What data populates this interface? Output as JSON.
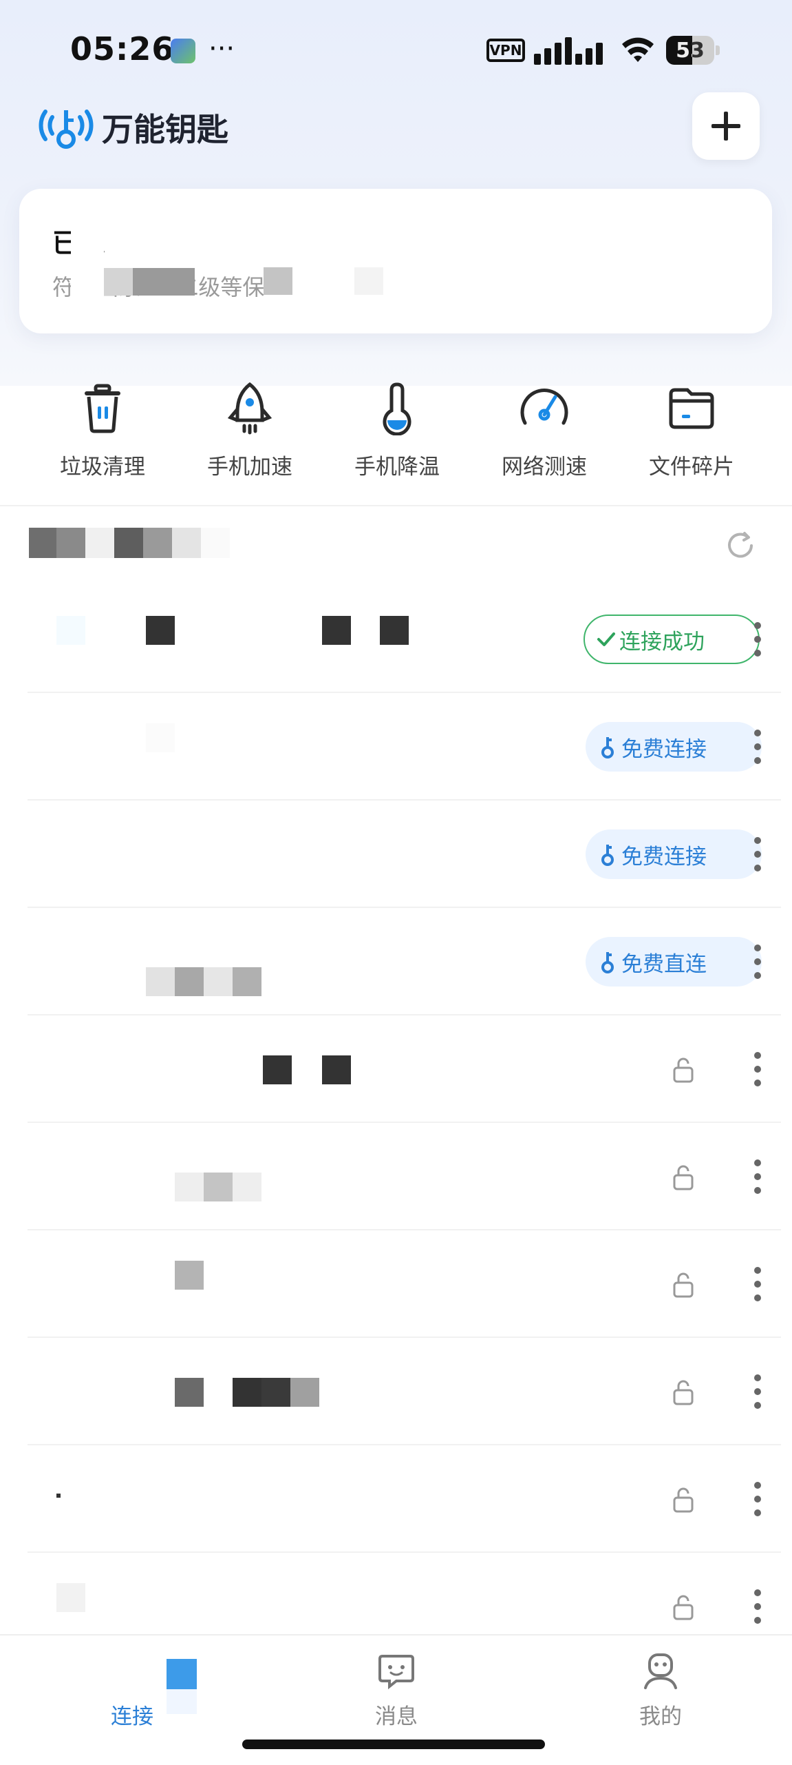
{
  "status_bar": {
    "time": "05:26",
    "dots": "···",
    "vpn": "VPN",
    "battery": "53"
  },
  "header": {
    "app_title": "万能钥匙",
    "add_icon": "plus-icon"
  },
  "connected_card": {
    "title": "已连",
    "subtitle": "符合国家 … 二级等保"
  },
  "tools": [
    {
      "label": "垃圾清理",
      "icon": "trash-icon"
    },
    {
      "label": "手机加速",
      "icon": "rocket-icon"
    },
    {
      "label": "手机降温",
      "icon": "thermometer-icon"
    },
    {
      "label": "网络测速",
      "icon": "speedometer-icon"
    },
    {
      "label": "文件碎片",
      "icon": "folder-icon"
    }
  ],
  "list": {
    "refresh_icon": "refresh-icon",
    "rows": [
      {
        "status": "连接成功",
        "type": "success"
      },
      {
        "status": "免费连接",
        "type": "free"
      },
      {
        "status": "免费连接",
        "type": "free"
      },
      {
        "status": "免费直连",
        "type": "free"
      },
      {
        "status": "",
        "type": "lock"
      },
      {
        "status": "",
        "type": "lock"
      },
      {
        "status": "",
        "type": "lock"
      },
      {
        "status": "",
        "type": "lock"
      },
      {
        "status": "",
        "type": "lock"
      },
      {
        "status": "",
        "type": "lock"
      }
    ]
  },
  "bottom_nav": {
    "items": [
      {
        "label": "连接",
        "icon": "wifi-key-icon",
        "active": true
      },
      {
        "label": "消息",
        "icon": "message-icon",
        "active": false
      },
      {
        "label": "我的",
        "icon": "profile-icon",
        "active": false
      }
    ]
  },
  "colors": {
    "accent": "#2b7fd6",
    "success": "#3fb56b",
    "free_pill_bg": "#eaf3ff",
    "header_bg": "#e8eefb"
  }
}
